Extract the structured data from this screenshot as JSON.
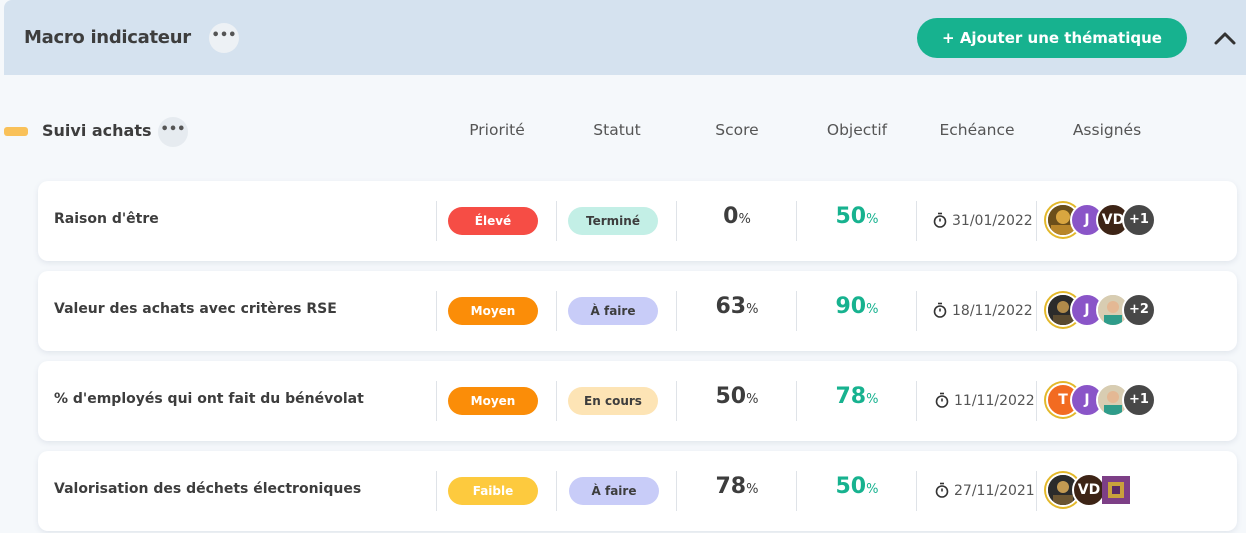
{
  "header": {
    "title": "Macro indicateur",
    "menu_glyph": "•••",
    "add_button": "+ Ajouter une thématique",
    "collapse_icon": "chevron-up-icon"
  },
  "section": {
    "title": "Suivi achats",
    "menu_glyph": "•••",
    "accent_color": "#f9c159",
    "columns": {
      "priority": "Priorité",
      "status": "Statut",
      "score": "Score",
      "objective": "Objectif",
      "deadline": "Echéance",
      "assigned": "Assignés"
    }
  },
  "colors": {
    "accent": "#17b28f",
    "priority_high": "#f64d45",
    "priority_medium": "#fb8d08",
    "priority_low": "#fdca3e",
    "status_done": "#c3efe6",
    "status_todo": "#c8ccf8",
    "status_inprogress": "#fde4b5"
  },
  "rows": [
    {
      "title": "Raison d'être",
      "priority": "Élevé",
      "status": "Terminé",
      "score": "0",
      "score_unit": "%",
      "objective": "50",
      "objective_unit": "%",
      "deadline": "31/01/2022",
      "assignees": [
        "photo",
        "J",
        "VD"
      ],
      "extra": "+1"
    },
    {
      "title": "Valeur des achats avec critères RSE",
      "priority": "Moyen",
      "status": "À faire",
      "score": "63",
      "score_unit": "%",
      "objective": "90",
      "objective_unit": "%",
      "deadline": "18/11/2022",
      "assignees": [
        "photo",
        "J",
        "photo"
      ],
      "extra": "+2"
    },
    {
      "title": "% d'employés qui ont fait du bénévolat",
      "priority": "Moyen",
      "status": "En cours",
      "score": "50",
      "score_unit": "%",
      "objective": "78",
      "objective_unit": "%",
      "deadline": "11/11/2022",
      "assignees": [
        "T",
        "J",
        "photo"
      ],
      "extra": "+1"
    },
    {
      "title": "Valorisation des déchets électroniques",
      "priority": "Faible",
      "status": "À faire",
      "score": "78",
      "score_unit": "%",
      "objective": "50",
      "objective_unit": "%",
      "deadline": "27/11/2021",
      "assignees": [
        "photo",
        "VD",
        "photo"
      ],
      "extra": ""
    }
  ]
}
